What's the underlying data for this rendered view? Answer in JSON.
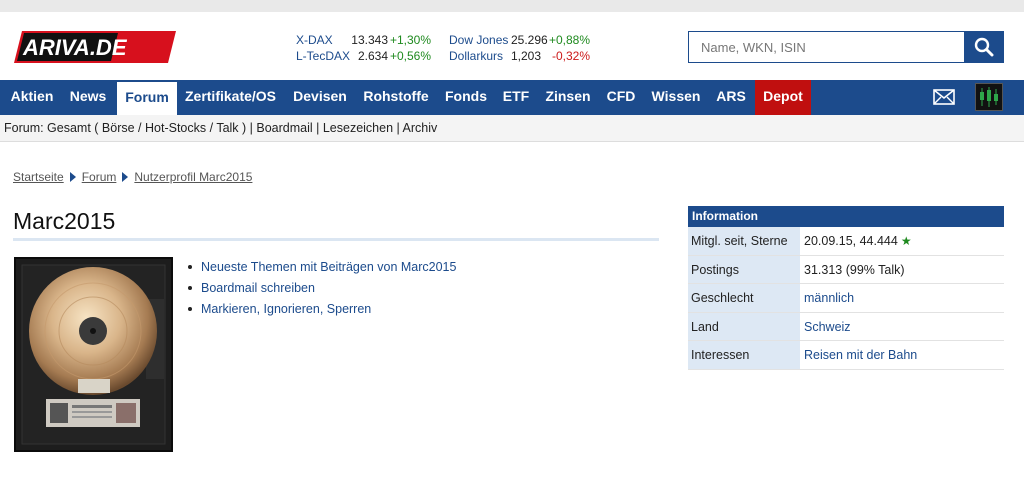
{
  "header": {
    "logo_text": "ARIVA.DE",
    "tickers_left": [
      {
        "name": "X-DAX",
        "value": "13.343",
        "change": "+1,30%",
        "trend": "up"
      },
      {
        "name": "L-TecDAX",
        "value": "2.634",
        "change": "+0,56%",
        "trend": "up"
      }
    ],
    "tickers_right": [
      {
        "name": "Dow Jones",
        "value": "25.296",
        "change": "+0,88%",
        "trend": "up"
      },
      {
        "name": "Dollarkurs",
        "value": "1,203",
        "change": "-0,32%",
        "trend": "down"
      }
    ],
    "search": {
      "placeholder": "Name, WKN, ISIN",
      "value": ""
    }
  },
  "nav": {
    "items": [
      {
        "label": "Aktien"
      },
      {
        "label": "News"
      },
      {
        "label": "Forum",
        "active": true
      },
      {
        "label": "Zertifikate/OS"
      },
      {
        "label": "Devisen"
      },
      {
        "label": "Rohstoffe"
      },
      {
        "label": "Fonds"
      },
      {
        "label": "ETF"
      },
      {
        "label": "Zinsen"
      },
      {
        "label": "CFD"
      },
      {
        "label": "Wissen"
      },
      {
        "label": "ARS"
      },
      {
        "label": "Depot",
        "highlight": true
      }
    ],
    "icons": [
      "mail-icon",
      "chart-icon"
    ]
  },
  "subbar": {
    "prefix": "Forum: ",
    "items": [
      "Gesamt",
      "Börse",
      "Hot-Stocks",
      "Talk",
      "Boardmail",
      "Lesezeichen",
      "Archiv"
    ],
    "text": "Forum: Gesamt ( Börse / Hot-Stocks / Talk ) | Boardmail | Lesezeichen | Archiv"
  },
  "breadcrumb": [
    "Startseite",
    "Forum",
    "Nutzerprofil Marc2015"
  ],
  "profile": {
    "name": "Marc2015",
    "links": {
      "themes": "Neueste Themen mit Beiträgen von Marc2015",
      "boardmail": "Boardmail schreiben",
      "mark": "Markieren",
      "ignore": "Ignorieren",
      "block": "Sperren"
    }
  },
  "info": {
    "heading": "Information",
    "rows": [
      {
        "label": "Mitgl. seit, Sterne",
        "value": "20.09.15, 44.444",
        "star": true
      },
      {
        "label": "Postings",
        "value": "31.313 (99% Talk)"
      },
      {
        "label": "Geschlecht",
        "value": "männlich",
        "link": true
      },
      {
        "label": "Land",
        "value": "Schweiz",
        "link": true
      },
      {
        "label": "Interessen",
        "value": "Reisen mit der Bahn",
        "link": true
      }
    ]
  },
  "colors": {
    "brand_blue": "#1c4b8c",
    "depot_red": "#c00f0f",
    "up_green": "#1f8a1f",
    "down_red": "#cc1a1a",
    "info_label_bg": "#dde8f4"
  }
}
